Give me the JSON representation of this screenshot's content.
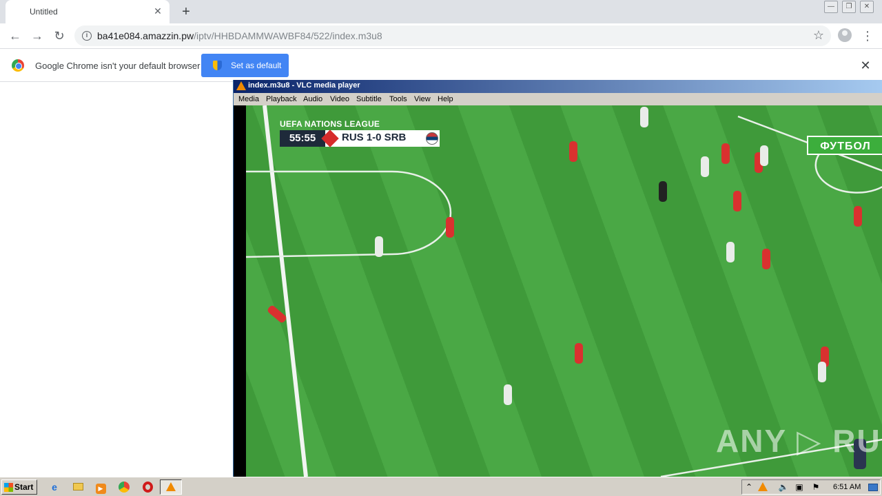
{
  "browser": {
    "tab_title": "Untitled",
    "tab_close": "✕",
    "new_tab": "+",
    "window_minimize": "—",
    "window_restore": "❐",
    "window_close": "✕",
    "nav_back": "←",
    "nav_forward": "→",
    "nav_reload": "↻",
    "url_host": "ba41e084.amazzin.pw",
    "url_path": "/iptv/HHBDAMMWAWBF84/522/index.m3u8",
    "star": "☆",
    "menu": "⋮",
    "info": "i"
  },
  "infobar": {
    "message": "Google Chrome isn't your default browser",
    "button_label": "Set as default",
    "close": "✕"
  },
  "vlc": {
    "title": "index.m3u8 - VLC media player",
    "menu": [
      "Media",
      "Playback",
      "Audio",
      "Video",
      "Subtitle",
      "Tools",
      "View",
      "Help"
    ],
    "overlay": {
      "league": "UEFA NATIONS LEAGUE",
      "clock": "55:55",
      "match": "RUS 1-0 SRB",
      "channel": "ФУТБОЛ"
    },
    "watermark": "ANY ▷ RUN"
  },
  "taskbar": {
    "start_label": "Start",
    "time": "6:51 AM"
  },
  "colors": {
    "chrome_blue": "#4285f4",
    "vlc_title_gradient_start": "#0a246a",
    "pitch_green": "#3f9a3a",
    "taskbar_gray": "#d4d0c8"
  }
}
